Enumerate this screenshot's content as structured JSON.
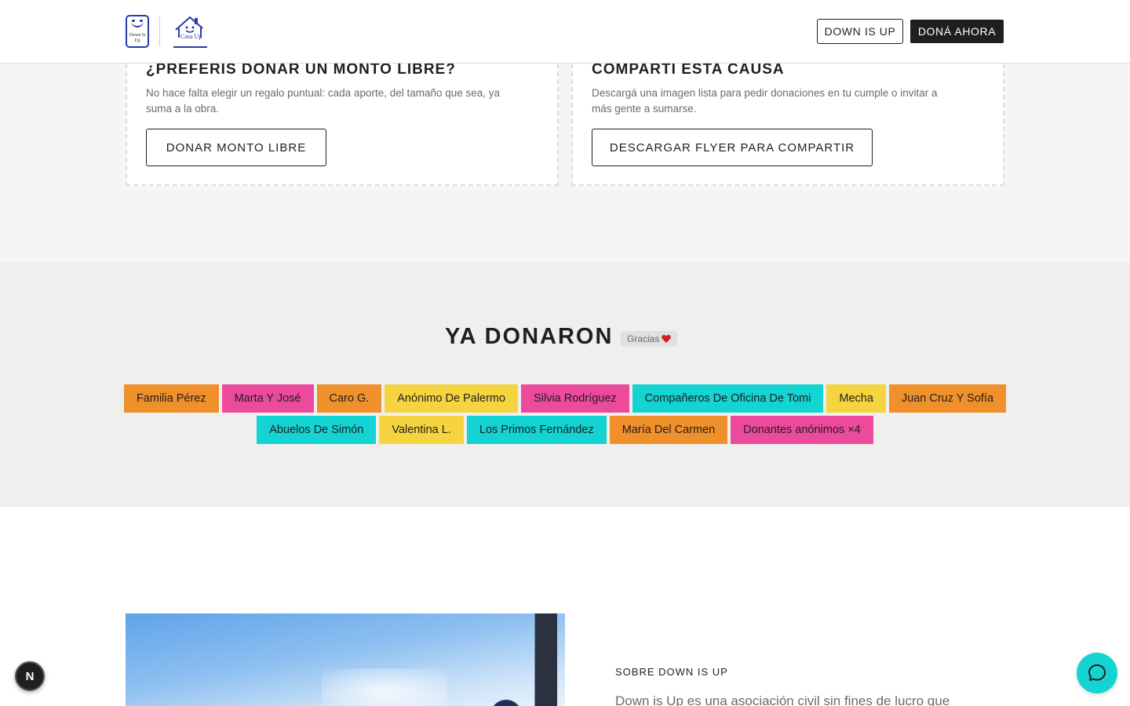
{
  "header": {
    "logo_a_text": "Down Is Up",
    "logo_b_text": "Casa Up",
    "nav_button": "DOWN IS UP",
    "cta_button": "DONÁ AHORA"
  },
  "cards": [
    {
      "title": "¿PREFERIS DONAR UN MONTO LIBRE?",
      "description": "No hace falta elegir un regalo puntual: cada aporte, del tamaño que sea, ya suma a la obra.",
      "button": "DONAR MONTO LIBRE"
    },
    {
      "title": "COMPARTI ESTA CAUSA",
      "description": "Descargá una imagen lista para pedir donaciones en tu cumple o invitar a más gente a sumarse.",
      "button": "DESCARGAR FLYER PARA COMPARTIR"
    }
  ],
  "donors": {
    "title": "YA DONARON",
    "badge": "Gracias",
    "badge_icon": "heart-icon",
    "row1": [
      {
        "name": "Familia Pérez",
        "color": "#f0902a"
      },
      {
        "name": "Marta Y José",
        "color": "#ec4a9c"
      },
      {
        "name": "Caro G.",
        "color": "#f0902a"
      },
      {
        "name": "Anónimo De Palermo",
        "color": "#f6d440"
      },
      {
        "name": "Silvia Rodríguez",
        "color": "#ec4a9c"
      },
      {
        "name": "Compañeros De Oficina De Tomi",
        "color": "#14d3d3"
      },
      {
        "name": "Mecha",
        "color": "#f6d440"
      },
      {
        "name": "Juan Cruz Y Sofía",
        "color": "#f0902a"
      }
    ],
    "row2": [
      {
        "name": "Abuelos De Simón",
        "color": "#14d3d3"
      },
      {
        "name": "Valentina L.",
        "color": "#f6d440"
      },
      {
        "name": "Los Primos Fernández",
        "color": "#14d3d3"
      },
      {
        "name": "María Del Carmen",
        "color": "#f0902a"
      },
      {
        "name": "Donantes anónimos ×4",
        "color": "#ec4a9c"
      }
    ]
  },
  "about": {
    "label": "SOBRE DOWN IS UP",
    "text": "Down is Up es una asociación civil sin fines de lucro que"
  },
  "floating": {
    "dev_badge": "N",
    "chat_icon": "chat-bubble-icon"
  }
}
